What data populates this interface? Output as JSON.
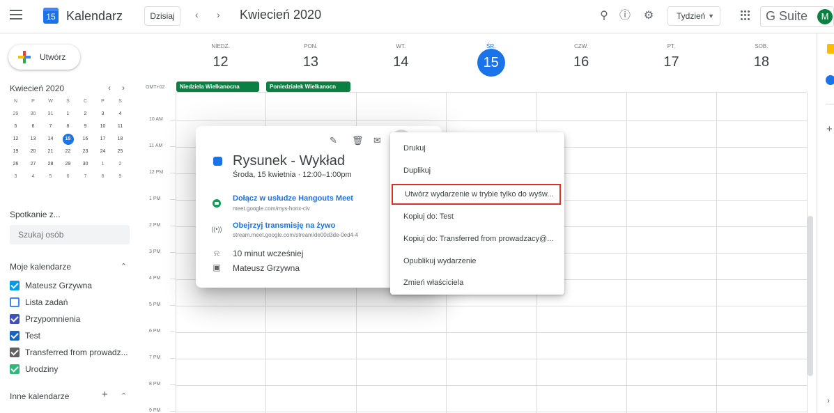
{
  "header": {
    "app_name": "Kalendarz",
    "logo_day": "15",
    "today_label": "Dzisiaj",
    "prev_arrow": "‹",
    "next_arrow": "›",
    "title": "Kwiecień 2020",
    "view_select": "Tydzień",
    "gsuite_label": "G Suite",
    "avatar_initial": "M"
  },
  "sidebar": {
    "create_label": "Utwórz",
    "mini_calendar": {
      "title": "Kwiecień 2020",
      "weekday_heads": [
        "N",
        "P",
        "W",
        "Ś",
        "C",
        "P",
        "S"
      ],
      "weeks": [
        [
          "29",
          "30",
          "31",
          "1",
          "2",
          "3",
          "4"
        ],
        [
          "5",
          "6",
          "7",
          "8",
          "9",
          "10",
          "11"
        ],
        [
          "12",
          "13",
          "14",
          "15",
          "16",
          "17",
          "18"
        ],
        [
          "19",
          "20",
          "21",
          "22",
          "23",
          "24",
          "25"
        ],
        [
          "26",
          "27",
          "28",
          "29",
          "30",
          "1",
          "2"
        ],
        [
          "3",
          "4",
          "5",
          "6",
          "7",
          "8",
          "9"
        ]
      ]
    },
    "meet_title": "Spotkanie z...",
    "search_people_placeholder": "Szukaj osób",
    "my_calendars_title": "Moje kalendarze",
    "my_calendars": [
      {
        "label": "Mateusz Grzywna",
        "color": "#039be5",
        "checked": true
      },
      {
        "label": "Lista zadań",
        "color": "#4285f4",
        "checked": false
      },
      {
        "label": "Przypomnienia",
        "color": "#3f51b5",
        "checked": true
      },
      {
        "label": "Test",
        "color": "#1565c0",
        "checked": true
      },
      {
        "label": "Transferred from prowadz...",
        "color": "#616161",
        "checked": true
      },
      {
        "label": "Urodziny",
        "color": "#33b679",
        "checked": true
      }
    ],
    "other_calendars_title": "Inne kalendarze"
  },
  "week": {
    "days": [
      {
        "name": "NIEDZ.",
        "num": "12"
      },
      {
        "name": "PON.",
        "num": "13"
      },
      {
        "name": "WT.",
        "num": "14"
      },
      {
        "name": "ŚR.",
        "num": "15",
        "today": true
      },
      {
        "name": "CZW.",
        "num": "16"
      },
      {
        "name": "PT.",
        "num": "17"
      },
      {
        "name": "SOB.",
        "num": "18"
      }
    ],
    "timezone": "GMT+02",
    "allday_events": [
      "Niedziela Wielkanocna",
      "Poniedziałek Wielkanocn"
    ],
    "hours": [
      "10 AM",
      "11 AM",
      "12 PM",
      "1 PM",
      "2 PM",
      "3 PM",
      "4 PM",
      "5 PM",
      "6 PM",
      "7 PM",
      "8 PM",
      "9 PM"
    ]
  },
  "event_popup": {
    "title": "Rysunek - Wykład",
    "time": "Środa, 15 kwietnia  ·  12:00–1:00pm",
    "meet_link": "Dołącz w usłudze Hangouts Meet",
    "meet_url": "meet.google.com/mys-honx-civ",
    "stream_link": "Obejrzyj transmisję na żywo",
    "stream_url": "stream.meet.google.com/stream/de00d3de-0ed4-4",
    "reminder": "10 minut wcześniej",
    "owner": "Mateusz Grzywna",
    "accent_color": "#1a73e8"
  },
  "context_menu": {
    "items": [
      "Drukuj",
      "Duplikuj",
      "Utwórz wydarzenie w trybie tylko do wyśw...",
      "Kopiuj do: Test",
      "Kopiuj do: Transferred from prowadzacy@...",
      "Opublikuj wydarzenie",
      "Zmień właściciela"
    ],
    "highlight_color": "#d93025"
  }
}
